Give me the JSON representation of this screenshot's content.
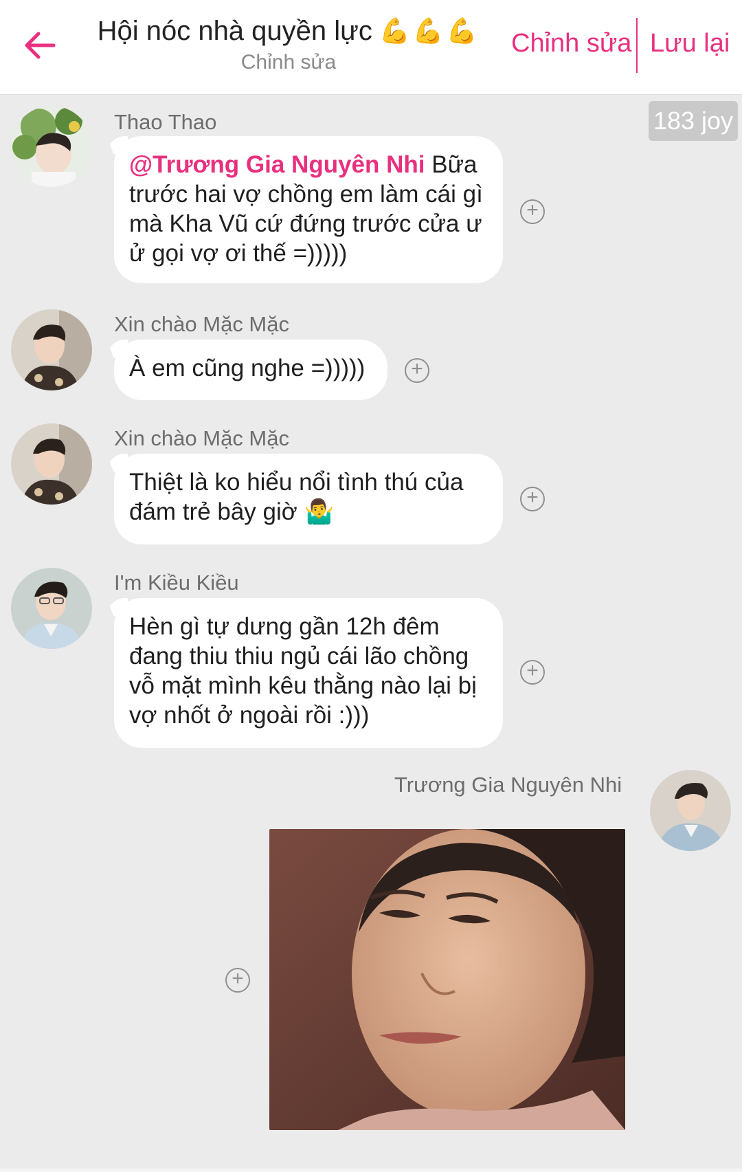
{
  "header": {
    "title": "Hội nóc nhà quyền lực",
    "title_emoji": "💪💪💪",
    "subtitle": "Chỉnh sửa",
    "edit_label": "Chỉnh sửa",
    "save_label": "Lưu lại",
    "back_icon": "arrow-left-icon",
    "accent_color": "#e8307f"
  },
  "joy_badge": "183 joy",
  "messages": [
    {
      "sender": "Thao Thao",
      "mention": "@Trương Gia Nguyên Nhi",
      "text_line1": " Bữa",
      "text_rest": "trước hai vợ chồng em làm cái gì mà Kha Vũ cứ đứng trước cửa ư ử gọi vợ ơi thế =)))))"
    },
    {
      "sender": "Xin chào Mặc Mặc",
      "text": "À em cũng nghe =)))))"
    },
    {
      "sender": "Xin chào Mặc Mặc",
      "text": "Thiệt là ko hiểu nổi tình thú của đám trẻ bây giờ",
      "emoji": "🤷‍♂️"
    },
    {
      "sender": "I'm Kiều Kiều",
      "text": "Hèn gì tự dưng gần 12h đêm đang thiu thiu ngủ cái lão chồng vỗ mặt mình kêu thằng nào lại bị vợ nhốt ở ngoài rồi :)))"
    },
    {
      "sender": "Trương Gia Nguyên Nhi",
      "attachment": "photo"
    }
  ],
  "react_icon": "plus-circle-icon",
  "react_symbol": "+"
}
